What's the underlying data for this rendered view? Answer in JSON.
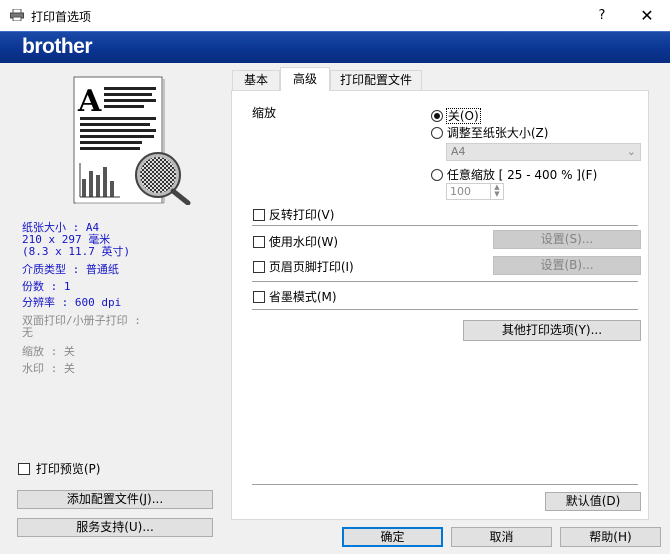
{
  "window": {
    "title": "打印首选项",
    "help": "?",
    "close": "✕"
  },
  "brand": {
    "logo": "brother"
  },
  "left": {
    "info_blue": [
      "纸张大小 : A4",
      "210 x 297 毫米",
      "(8.3 x 11.7 英寸)",
      "介质类型 : 普通纸",
      "份数 : 1",
      "分辨率 : 600 dpi"
    ],
    "info_gray": [
      "双面打印/小册子打印 :",
      "无",
      "缩放 : 关",
      "水印 : 关"
    ],
    "print_preview": "打印预览(P)",
    "add_profile": "添加配置文件(J)...",
    "support": "服务支持(U)..."
  },
  "tabs": [
    "基本",
    "高级",
    "打印配置文件"
  ],
  "advanced": {
    "scaling_label": "缩放",
    "scale_off": "关(O)",
    "scale_fit": "调整至纸张大小(Z)",
    "paper_select": "A4",
    "scale_free": "任意缩放 [ 25 - 400 % ](F)",
    "scale_value": "100",
    "reverse_print": "反转打印(V)",
    "watermark": "使用水印(W)",
    "watermark_settings": "设置(S)...",
    "header_footer": "页眉页脚打印(I)",
    "header_footer_settings": "设置(B)...",
    "toner_save": "省墨模式(M)",
    "other_options": "其他打印选项(Y)...",
    "default": "默认值(D)"
  },
  "footer": {
    "ok": "确定",
    "cancel": "取消",
    "help": "帮助(H)"
  }
}
